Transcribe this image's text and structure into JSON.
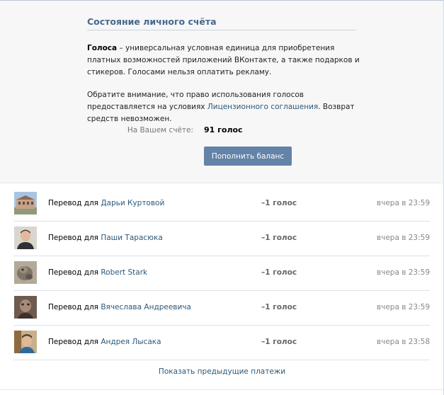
{
  "header": {
    "title": "Состояние личного счёта",
    "desc_bold": "Голоса",
    "desc_text": " – универсальная условная единица для приобретения платных возможностей приложений ВКонтакте, а также подарков и стикеров. Голосами нельзя оплатить рекламу.",
    "notice_before": "Обратите внимание, что право использования голосов предоставляется на условиях ",
    "notice_link": "Лицензионного соглашения",
    "notice_after": ". Возврат средств невозможен."
  },
  "balance": {
    "label": "На Вашем счёте:",
    "value": "91 голос",
    "button_label": "Пополнить баланс"
  },
  "transactions": [
    {
      "prefix": "Перевод для",
      "name": "Дарьи Куртовой",
      "amount": "–1 голос",
      "date": "вчера в 23:59"
    },
    {
      "prefix": "Перевод для",
      "name": "Паши Тарасюка",
      "amount": "–1 голос",
      "date": "вчера в 23:59"
    },
    {
      "prefix": "Перевод для",
      "name": "Robert Stark",
      "amount": "–1 голос",
      "date": "вчера в 23:59"
    },
    {
      "prefix": "Перевод для",
      "name": "Вячеслава Андреевича",
      "amount": "–1 голос",
      "date": "вчера в 23:59"
    },
    {
      "prefix": "Перевод для",
      "name": "Андрея Лысака",
      "amount": "–1 голос",
      "date": "вчера в 23:58"
    }
  ],
  "footer": {
    "more_link": "Показать предыдущие платежи"
  },
  "colors": {
    "link": "#2b587a",
    "title": "#45688e",
    "button": "#6383a8"
  }
}
